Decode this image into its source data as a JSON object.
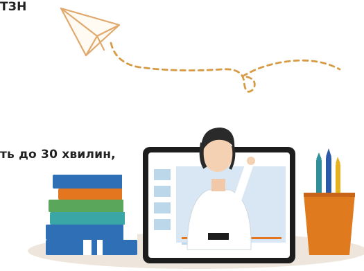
{
  "caption_top": "ТЗН",
  "caption_middle": "ть до 30 хвилин,",
  "colors": {
    "accent_orange": "#e07a1f",
    "plane_stroke": "#e0a96d",
    "path_dash": "#d79b45",
    "floor_shadow": "#eee6dc",
    "frame_dark": "#1d1d1d",
    "screen_blue": "#d8e7f3",
    "screen_panel": "#bcd6ea",
    "book_blue": "#2f6fb5",
    "book_teal": "#3aa7a6",
    "book_orange": "#e4761f",
    "book_green": "#5aa65a",
    "pencil_teal": "#2f8f9a",
    "pencil_blue": "#2d5aa8",
    "pencil_yellow": "#e8b21e"
  },
  "icons": {
    "paper_plane": "paper-plane-icon",
    "books": "books-stack-icon",
    "tablet": "tablet-video-icon",
    "pencil_cup": "pencil-cup-icon"
  }
}
